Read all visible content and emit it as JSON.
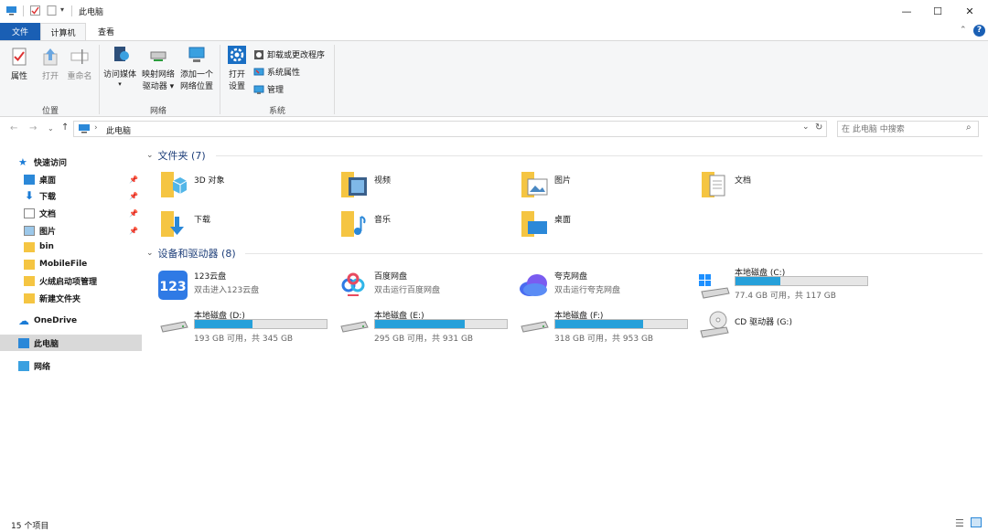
{
  "window": {
    "title": "此电脑",
    "controls": [
      "—",
      "☐",
      "✕"
    ]
  },
  "tabs": {
    "file": "文件",
    "computer": "计算机",
    "view": "查看"
  },
  "ribbon": {
    "location": {
      "label": "位置",
      "properties": "属性",
      "open": "打开",
      "rename": "重命名"
    },
    "network": {
      "label": "网络",
      "access_media": "访问媒体",
      "map_drive_1": "映射网络",
      "map_drive_2": "驱动器",
      "add_location_1": "添加一个",
      "add_location_2": "网络位置"
    },
    "system": {
      "label": "系统",
      "open_settings_1": "打开",
      "open_settings_2": "设置",
      "uninstall": "卸载或更改程序",
      "system_properties": "系统属性",
      "manage": "管理"
    }
  },
  "address": {
    "path": "此电脑",
    "search_placeholder": "在 此电脑 中搜索"
  },
  "sidebar": {
    "quick_access": "快速访问",
    "items": [
      {
        "label": "桌面",
        "pinned": true
      },
      {
        "label": "下载",
        "pinned": true
      },
      {
        "label": "文档",
        "pinned": true
      },
      {
        "label": "图片",
        "pinned": true
      },
      {
        "label": "bin",
        "pinned": false
      },
      {
        "label": "MobileFile",
        "pinned": false
      },
      {
        "label": "火绒启动项管理",
        "pinned": false
      },
      {
        "label": "新建文件夹",
        "pinned": false
      }
    ],
    "onedrive": "OneDrive",
    "this_pc": "此电脑",
    "network": "网络"
  },
  "folders": {
    "header": "文件夹 (7)",
    "items": [
      "3D 对象",
      "视频",
      "图片",
      "文档",
      "下载",
      "音乐",
      "桌面"
    ]
  },
  "devices": {
    "header": "设备和驱动器 (8)",
    "apps": [
      {
        "name": "123云盘",
        "sub": "双击进入123云盘"
      },
      {
        "name": "百度网盘",
        "sub": "双击运行百度网盘"
      },
      {
        "name": "夸克网盘",
        "sub": "双击运行夸克网盘"
      }
    ],
    "drives": [
      {
        "name": "本地磁盘 (C:)",
        "free": "77.4 GB 可用，共 117 GB",
        "used_fraction": 0.34
      },
      {
        "name": "本地磁盘 (D:)",
        "free": "193 GB 可用，共 345 GB",
        "used_fraction": 0.44
      },
      {
        "name": "本地磁盘 (E:)",
        "free": "295 GB 可用，共 931 GB",
        "used_fraction": 0.68
      },
      {
        "name": "本地磁盘 (F:)",
        "free": "318 GB 可用，共 953 GB",
        "used_fraction": 0.67
      }
    ],
    "cd": {
      "name": "CD 驱动器 (G:)"
    }
  },
  "status": {
    "count": "15 个项目"
  },
  "colors": {
    "accent": "#1a5fb4",
    "bar": "#26a0da",
    "folder": "#f5c542",
    "section": "#1e3f7a"
  }
}
